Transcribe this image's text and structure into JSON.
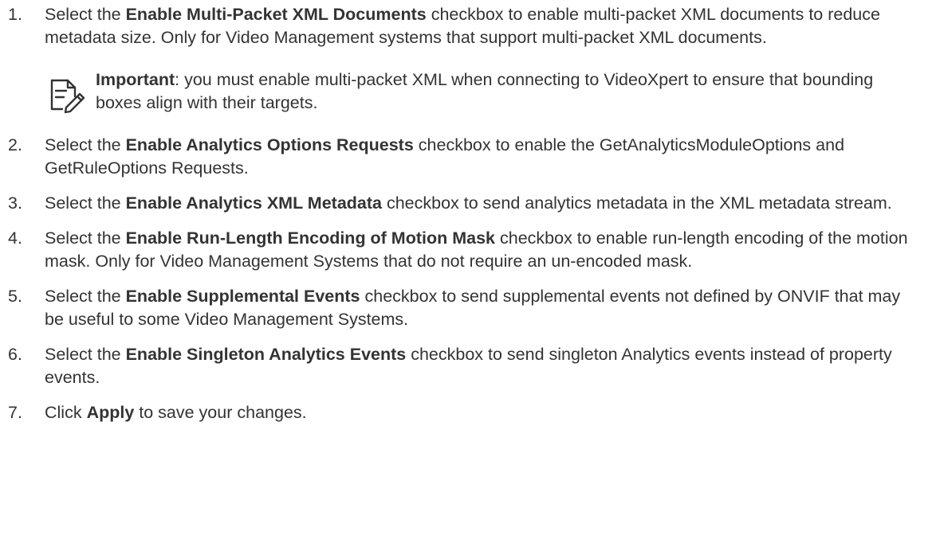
{
  "steps": [
    {
      "number": "1.",
      "pre": "Select the ",
      "bold": "Enable Multi-Packet XML Documents",
      "post": " checkbox to enable multi-packet XML documents to reduce metadata size. Only for Video Management systems that support multi-packet XML documents."
    },
    {
      "number": "2.",
      "pre": "Select the ",
      "bold": "Enable Analytics Options Requests",
      "post": " checkbox to enable the GetAnalyticsModuleOptions and GetRuleOptions Requests."
    },
    {
      "number": "3.",
      "pre": "Select the ",
      "bold": "Enable Analytics XML Metadata",
      "post": " checkbox to send analytics metadata in the XML metadata stream."
    },
    {
      "number": "4.",
      "pre": "Select the ",
      "bold": "Enable Run-Length Encoding of Motion Mask",
      "post": " checkbox to enable run-length encoding of the motion mask. Only for Video Management Systems that do not require an un-encoded mask."
    },
    {
      "number": "5.",
      "pre": "Select the ",
      "bold": "Enable Supplemental Events",
      "post": " checkbox to send supplemental events not defined by ONVIF that may be useful to some Video Management Systems."
    },
    {
      "number": "6.",
      "pre": "Select the ",
      "bold": "Enable Singleton Analytics Events",
      "post": " checkbox to send singleton Analytics events instead of property events."
    },
    {
      "number": "7.",
      "pre": "Click ",
      "bold": "Apply",
      "post": " to save your changes."
    }
  ],
  "note": {
    "icon": "notepad-pencil-icon",
    "label": "Important",
    "text": ": you must enable multi-packet XML when connecting to VideoXpert to ensure that bounding boxes align with their targets."
  },
  "colors": {
    "text": "#333333",
    "icon": "#333333"
  }
}
